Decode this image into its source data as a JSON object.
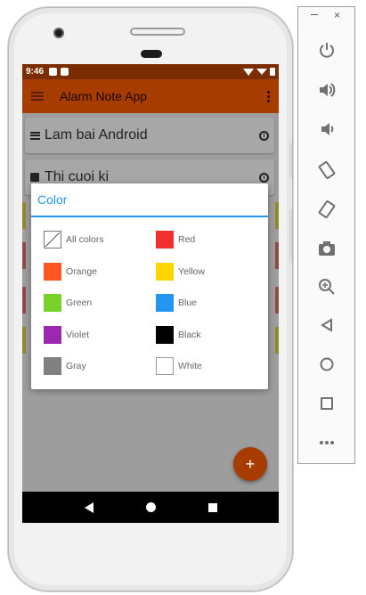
{
  "statusbar": {
    "time": "9:46"
  },
  "appbar": {
    "title": "Alarm Note App"
  },
  "notes": [
    {
      "title": "Lam bai Android"
    },
    {
      "title": "Thi cuoi ki"
    }
  ],
  "dialog": {
    "title": "Color",
    "options": [
      {
        "label": "All colors",
        "color": "#ffffff",
        "icon": "all-colors-icon"
      },
      {
        "label": "Red",
        "color": "#f03030"
      },
      {
        "label": "Orange",
        "color": "#ff5722"
      },
      {
        "label": "Yellow",
        "color": "#ffd600"
      },
      {
        "label": "Green",
        "color": "#76d12a"
      },
      {
        "label": "Blue",
        "color": "#2196f3"
      },
      {
        "label": "Violet",
        "color": "#9c27b0"
      },
      {
        "label": "Black",
        "color": "#000000"
      },
      {
        "label": "Gray",
        "color": "#808080"
      },
      {
        "label": "White",
        "color": "#ffffff"
      }
    ]
  },
  "fab": {
    "label": "+"
  },
  "colors": {
    "primary": "#a63c00",
    "primary_dark": "#7a2d00",
    "accent": "#2196f3"
  },
  "emulator_toolbar": {
    "buttons": [
      "power-icon",
      "volume-up-icon",
      "volume-down-icon",
      "rotate-left-icon",
      "rotate-right-icon",
      "camera-icon",
      "zoom-icon",
      "back-icon",
      "home-icon",
      "overview-icon",
      "more-icon"
    ]
  }
}
